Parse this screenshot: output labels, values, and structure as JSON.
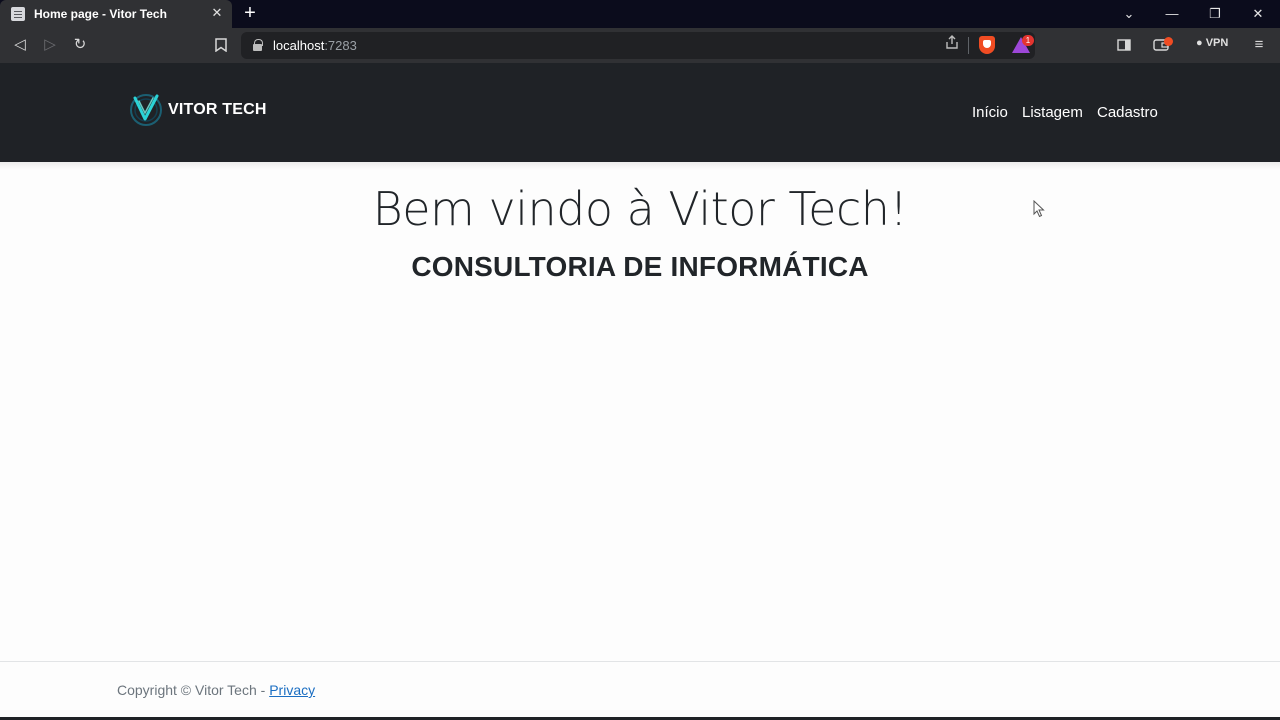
{
  "browser": {
    "tab_title": "Home page - Vitor Tech",
    "tab_close": "✕",
    "new_tab": "+",
    "url_host": "localhost",
    "url_port": ":7283",
    "rewards_count": "1",
    "vpn_label": "VPN",
    "window_controls": {
      "dropdown": "⌄",
      "minimize": "—",
      "restore": "❐",
      "close": "✕"
    },
    "nav_icons": {
      "back": "◁",
      "forward": "▷",
      "reload": "↻",
      "bookmark": "🔖",
      "share": "⇪",
      "sidebar": "▣",
      "wallet": "▭",
      "menu": "≡"
    }
  },
  "site": {
    "logo_text": "VITOR TECH",
    "nav": [
      {
        "label": "Início"
      },
      {
        "label": "Listagem"
      },
      {
        "label": "Cadastro"
      }
    ],
    "hero_title": "Bem vindo à Vitor Tech!",
    "hero_subtitle": "CONSULTORIA DE INFORMÁTICA",
    "footer": {
      "copyright": "Copyright © Vitor Tech - ",
      "privacy_link": "Privacy"
    }
  },
  "colors": {
    "header_bg": "#1f2226",
    "page_bg": "#fdfdfd",
    "link": "#1b6ec2",
    "brave_orange": "#f04c23"
  }
}
